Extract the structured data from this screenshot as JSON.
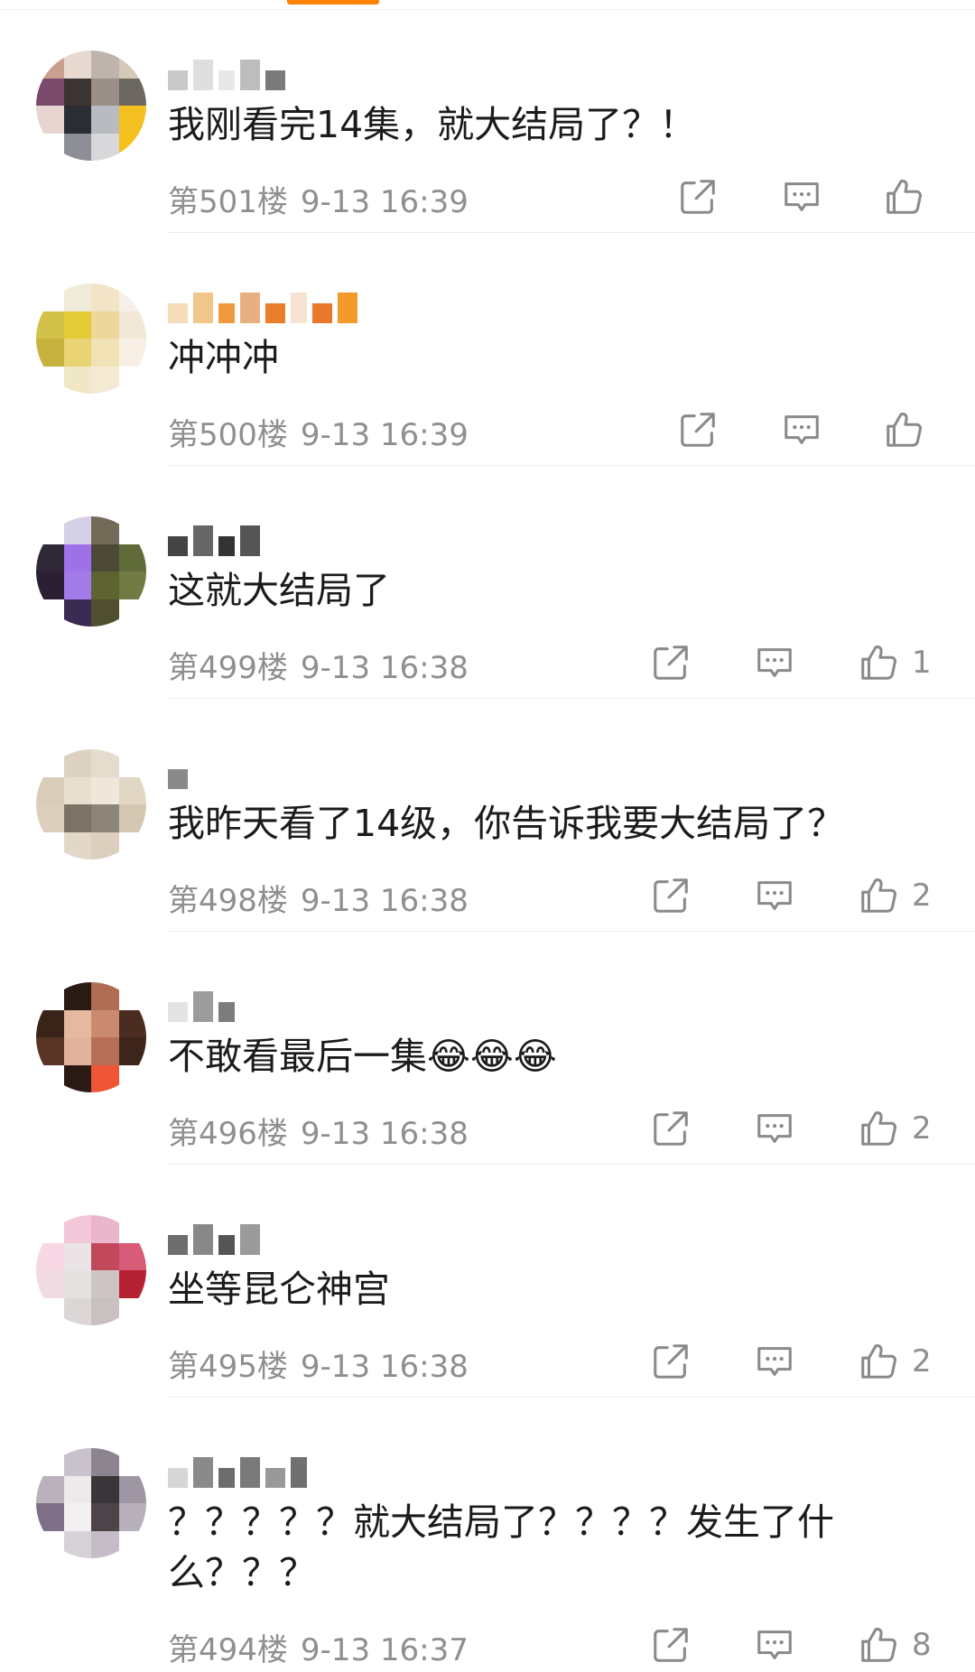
{
  "comments": [
    {
      "text": "我刚看完14集，就大结局了？！",
      "floor": "第501楼",
      "time": "9-13 16:39",
      "likes": "",
      "avatar_colors": [
        "#c9a08f",
        "#e7d9cf",
        "#bfb4ab",
        "#d7c9b9",
        "#7a4a6b",
        "#3a3532",
        "#9a8f86",
        "#6d6762",
        "#e6d5d0",
        "#2a2d33",
        "#b8bcc0",
        "#f4c020",
        "#ffffff",
        "#8e8e96",
        "#d8d8da",
        "#f6c21a"
      ],
      "name_blocks": [
        "#c9c9c9",
        "#dedede",
        "#e8e8e8",
        "#bdbdbd",
        "#7a7a7a"
      ]
    },
    {
      "text": "冲冲冲",
      "floor": "第500楼",
      "time": "9-13 16:39",
      "likes": "",
      "avatar_colors": [
        "#ffffff",
        "#f0ead9",
        "#f1e4c7",
        "#f6f1e8",
        "#d3c24a",
        "#e3cb35",
        "#eed79a",
        "#f2e8d8",
        "#c7b23d",
        "#e9d374",
        "#f1e2b5",
        "#f7efe3",
        "#ffffff",
        "#efe7c6",
        "#f4ead4",
        "#ffffff"
      ],
      "name_blocks": [
        "#f6dcb8",
        "#f2c58a",
        "#ef9a3d",
        "#e8b080",
        "#e97d2c",
        "#f6e4d0",
        "#e9782a",
        "#f49a2a"
      ]
    },
    {
      "text": "这就大结局了",
      "floor": "第499楼",
      "time": "9-13 16:38",
      "likes": "1",
      "avatar_colors": [
        "#ffffff",
        "#d5d0e6",
        "#736a58",
        "#ffffff",
        "#2e2837",
        "#9d71e8",
        "#4c4a37",
        "#616b3a",
        "#2b2033",
        "#a37be9",
        "#5e6331",
        "#717a42",
        "#ffffff",
        "#3b2b52",
        "#4f4f30",
        "#ffffff"
      ],
      "name_blocks": [
        "#444444",
        "#666666",
        "#333333",
        "#555555"
      ]
    },
    {
      "text": "我昨天看了14级，你告诉我要大结局了？",
      "floor": "第498楼",
      "time": "9-13 16:38",
      "likes": "2",
      "avatar_colors": [
        "#ffffff",
        "#ddd2c2",
        "#e5dccd",
        "#ffffff",
        "#d9cdb9",
        "#e8dfcf",
        "#efe7da",
        "#e2d6c4",
        "#dccfbb",
        "#7a7366",
        "#8d857a",
        "#d5c8b3",
        "#ffffff",
        "#e3d8c8",
        "#dccfbd",
        "#ffffff"
      ],
      "name_blocks": [
        "#8a8a8a"
      ]
    },
    {
      "text": "不敢看最后一集😂😂😂",
      "floor": "第496楼",
      "time": "9-13 16:38",
      "likes": "2",
      "avatar_colors": [
        "#ffffff",
        "#2a1a14",
        "#b06d54",
        "#ffffff",
        "#3a241a",
        "#e6b8a0",
        "#c98a6f",
        "#4a2c21",
        "#5a3527",
        "#e2b39b",
        "#b56f58",
        "#3d251b",
        "#ffffff",
        "#2b1a14",
        "#f05535",
        "#ffffff"
      ],
      "name_blocks": [
        "#e4e4e4",
        "#9c9c9c",
        "#7c7c7c"
      ]
    },
    {
      "text": "坐等昆仑神宫",
      "floor": "第495楼",
      "time": "9-13 16:38",
      "likes": "2",
      "avatar_colors": [
        "#ffffff",
        "#f3c7d8",
        "#e9b6cb",
        "#ffffff",
        "#f7d7e3",
        "#eae4e6",
        "#c2495c",
        "#d85b78",
        "#f1dbe3",
        "#e4e2e1",
        "#cbc6c4",
        "#b52233",
        "#ffffff",
        "#dcd7d6",
        "#c8c1c0",
        "#ffffff"
      ],
      "name_blocks": [
        "#6e6e6e",
        "#888888",
        "#555555",
        "#9a9a9a"
      ]
    },
    {
      "text": "？？？？？就大结局了？？？？发生了什么？？？",
      "floor": "第494楼",
      "time": "9-13 16:37",
      "likes": "8",
      "avatar_colors": [
        "#ffffff",
        "#c9c2cc",
        "#8c8590",
        "#ffffff",
        "#b9b2bb",
        "#eceaeb",
        "#3a3538",
        "#9e96a2",
        "#7f6f86",
        "#f2f0f1",
        "#4c4448",
        "#b7afb9",
        "#ffffff",
        "#d7d2d8",
        "#c4bcc6",
        "#ffffff"
      ],
      "name_blocks": [
        "#d6d6d6",
        "#8a8a8a",
        "#6d6d6d",
        "#7a7a7a",
        "#999999",
        "#707070"
      ]
    }
  ]
}
